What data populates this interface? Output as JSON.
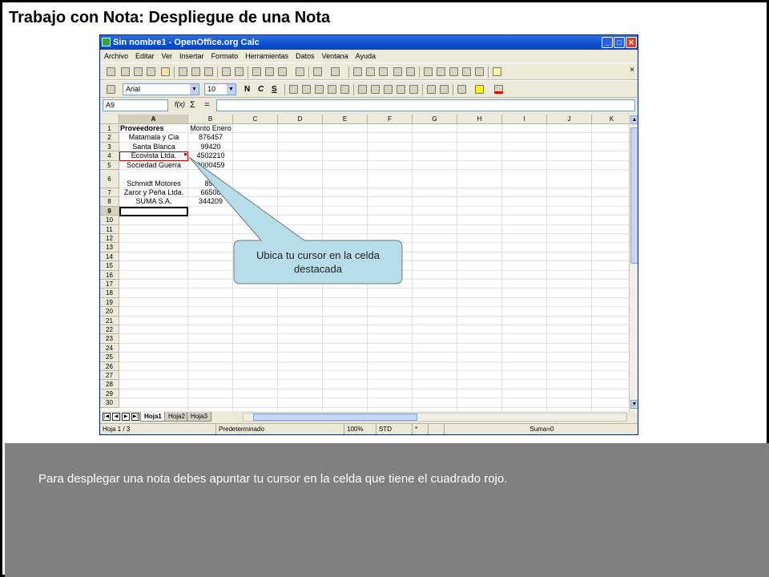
{
  "slide": {
    "title": "Trabajo con Nota: Despliegue de una Nota",
    "caption": "Para desplegar una nota debes apuntar tu cursor en la celda que tiene el cuadrado rojo.",
    "callout": "Ubica tu cursor en la celda destacada",
    "colors": {
      "caption_bg": "#808080",
      "callout_fill": "#b7dde8",
      "note_marker": "#e00000"
    }
  },
  "window": {
    "title": "Sin nombre1 - OpenOffice.org Calc",
    "menu": [
      "Archivo",
      "Editar",
      "Ver",
      "Insertar",
      "Formato",
      "Herramientas",
      "Datos",
      "Ventana",
      "Ayuda"
    ],
    "close_doc": "×",
    "btn_min": "_",
    "btn_max": "□",
    "btn_close": "✕"
  },
  "format_bar": {
    "font": "Arial",
    "size": "10",
    "bold": "N",
    "italic": "C",
    "underline": "S"
  },
  "formula_bar": {
    "name_box": "A9",
    "fx_symbol": "f(x)",
    "sum_symbol": "Σ",
    "equals_symbol": "="
  },
  "sheet": {
    "columns": [
      "A",
      "B",
      "C",
      "D",
      "E",
      "F",
      "G",
      "H",
      "I",
      "J",
      "K"
    ],
    "rows": [
      "1",
      "2",
      "3",
      "4",
      "5",
      "6",
      "7",
      "8",
      "9",
      "10",
      "11",
      "12",
      "13",
      "14",
      "15",
      "16",
      "17",
      "18",
      "19",
      "20",
      "21",
      "22",
      "23",
      "24",
      "25",
      "26",
      "27",
      "28",
      "29",
      "30"
    ],
    "cells": [
      {
        "a": "Proveedores",
        "b": "Monto Enero"
      },
      {
        "a": "Matamala y Cia",
        "b": "876457"
      },
      {
        "a": "Santa Blanca",
        "b": "99420"
      },
      {
        "a": "Ecovista Ltda.",
        "b": "4502210"
      },
      {
        "a": "Sociedad Guerra",
        "b": "9000459"
      },
      {
        "a": "Schmidt Motores",
        "b": "892"
      },
      {
        "a": "Zaror y Peña Ltda.",
        "b": "66508"
      },
      {
        "a": "SUMA S.A.",
        "b": "344209"
      }
    ],
    "tabs": [
      "Hoja1",
      "Hoja2",
      "Hoja3"
    ]
  },
  "status": {
    "sheet": "Hoja 1 / 3",
    "style": "Predeterminado",
    "zoom": "100%",
    "mode": "STD",
    "modified": "*",
    "sum": "Suma=0"
  }
}
